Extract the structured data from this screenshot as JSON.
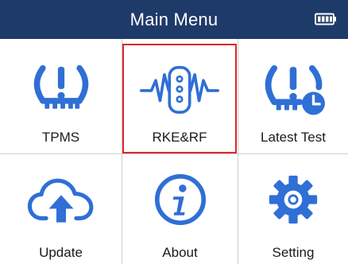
{
  "header": {
    "title": "Main Menu",
    "battery_icon": "battery-full-icon",
    "bg_color": "#1e3a68"
  },
  "menu": {
    "accent_color": "#2f6fd6",
    "selected_color": "#e0262a",
    "selected_item": "rke-rf",
    "items": [
      {
        "id": "tpms",
        "label": "TPMS",
        "icon": "tire-pressure-icon"
      },
      {
        "id": "rke-rf",
        "label": "RKE&RF",
        "icon": "key-fob-signal-icon"
      },
      {
        "id": "latest-test",
        "label": "Latest Test",
        "icon": "tire-pressure-clock-icon"
      },
      {
        "id": "update",
        "label": "Update",
        "icon": "cloud-upload-icon"
      },
      {
        "id": "about",
        "label": "About",
        "icon": "info-icon"
      },
      {
        "id": "setting",
        "label": "Setting",
        "icon": "gear-icon"
      }
    ]
  }
}
